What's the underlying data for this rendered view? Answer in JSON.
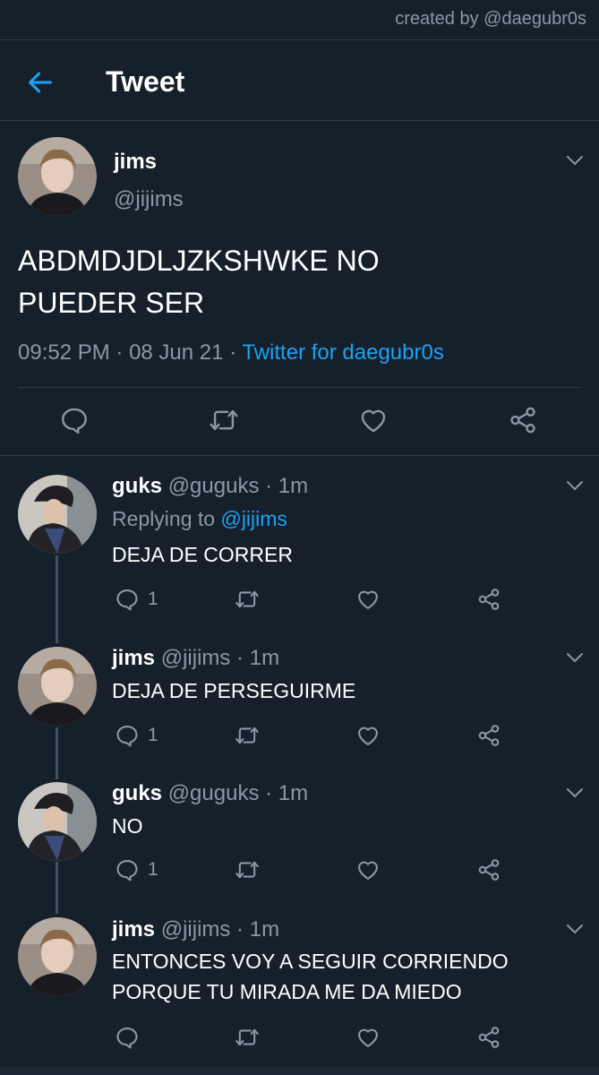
{
  "credit": "created by @daegubr0s",
  "header": {
    "title": "Tweet"
  },
  "tweet": {
    "name": "jims",
    "handle": "@jijims",
    "text_line1": "ABDMDJDLJZKSHWKE NO",
    "text_line2": "PUEDER SER",
    "time": "09:52 PM",
    "date": "08 Jun 21",
    "source": "Twitter for daegubr0s",
    "sep": " · "
  },
  "replies": [
    {
      "name": "guks",
      "handle": "@guguks",
      "time": "1m",
      "replying_label": "Replying to",
      "replying_to": "@jijims",
      "text": "DEJA DE CORRER",
      "reply_count": "1"
    },
    {
      "name": "jims",
      "handle": "@jijims",
      "time": "1m",
      "text": "DEJA DE PERSEGUIRME",
      "reply_count": "1"
    },
    {
      "name": "guks",
      "handle": "@guguks",
      "time": "1m",
      "text": "NO",
      "reply_count": "1"
    },
    {
      "name": "jims",
      "handle": "@jijims",
      "time": "1m",
      "text_line1": "ENTONCES VOY A SEGUIR CORRIENDO",
      "text_line2": "PORQUE TU MIRADA ME DA MIEDO"
    }
  ],
  "icons": {
    "back": "arrow-left-icon",
    "chevron": "chevron-down-icon",
    "reply": "reply-icon",
    "retweet": "retweet-icon",
    "like": "heart-icon",
    "share": "share-icon"
  },
  "colors": {
    "background": "#16202b",
    "accent": "#1da1f2",
    "muted": "#8899a6",
    "divider": "#2f3b47"
  }
}
